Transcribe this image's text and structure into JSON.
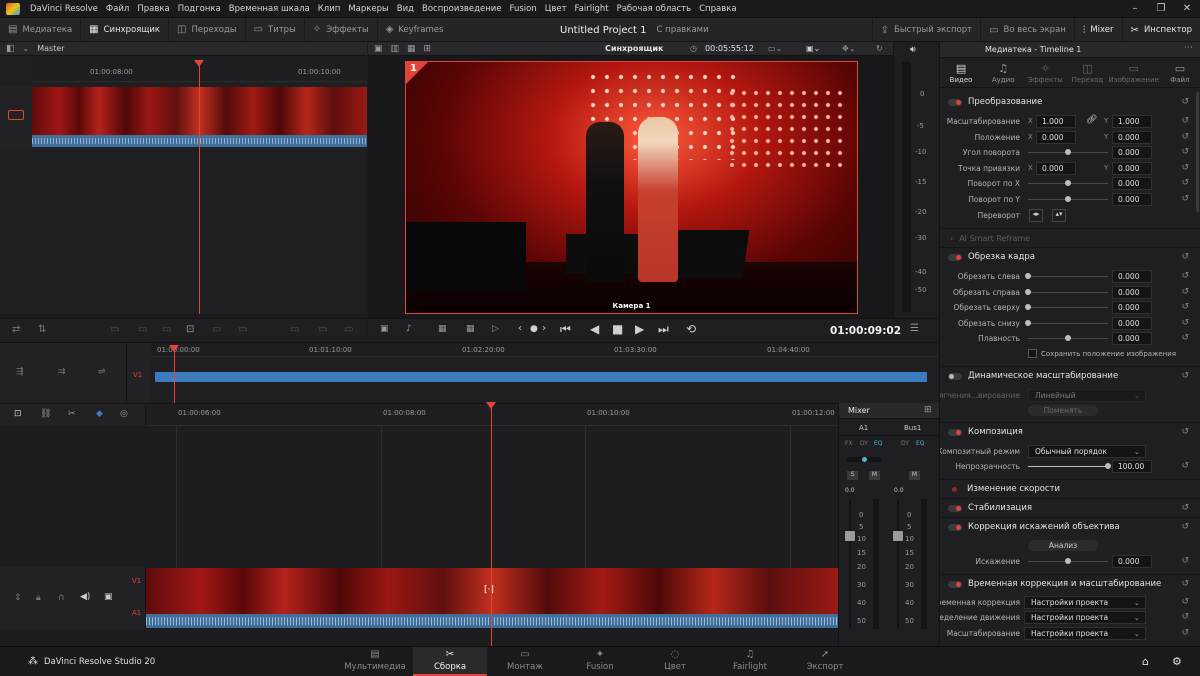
{
  "app": {
    "name": "DaVinci Resolve"
  },
  "menu": [
    "Файл",
    "Правка",
    "Подгонка",
    "Временная шкала",
    "Клип",
    "Маркеры",
    "Вид",
    "Воспроизведение",
    "Fusion",
    "Цвет",
    "Fairlight",
    "Рабочая область",
    "Справка"
  ],
  "toolbar": {
    "media_pool": "Медиатека",
    "sync_bin": "Синхроящик",
    "transitions": "Переходы",
    "titles": "Титры",
    "effects": "Эффекты",
    "keyframes": "Keyframes",
    "project_title": "Untitled Project 1",
    "project_status": "С правками",
    "quick_export": "Быстрый экспорт",
    "fullscreen": "Во весь экран",
    "mixer": "Mixer",
    "inspector": "Инспектор"
  },
  "source_panel": {
    "label": "Master",
    "ticks": [
      "01:00:08:00",
      "01:00:10:00"
    ]
  },
  "viewer": {
    "title": "Синхроящик",
    "timecode": "00:05:55:12",
    "cam_number": "1",
    "cam_label": "Камера 1",
    "playhead_tc": "01:00:09:02"
  },
  "upper_timeline": {
    "track": "V1",
    "ticks": [
      "01:00:00:00",
      "01:01:10:00",
      "01:02:20:00",
      "01:03:30:00",
      "01:04:40:00"
    ]
  },
  "lower_timeline": {
    "ticks": [
      "01:00:06:00",
      "01:00:08:00",
      "01:00:10:00",
      "01:00:12:00"
    ],
    "video_track": "V1",
    "audio_track": "A1"
  },
  "mixer": {
    "title": "Mixer",
    "channels": [
      "A1",
      "Bus1"
    ],
    "a1_fx": [
      "FX",
      "DY",
      "EQ"
    ],
    "bus_fx": [
      "DY",
      "EQ"
    ],
    "solo": "S",
    "mute": "M",
    "level": "0.0",
    "scale": [
      "0",
      "5",
      "10",
      "15",
      "20",
      "30",
      "40",
      "50"
    ]
  },
  "meter_scale": [
    "0",
    "-5",
    "-10",
    "-15",
    "-20",
    "-30",
    "-40",
    "-50"
  ],
  "inspector": {
    "header": "Медиатека - Timeline 1",
    "tabs": [
      "Видео",
      "Аудио",
      "Эффекты",
      "Переход",
      "Изображение",
      "Файл"
    ],
    "transform": {
      "title": "Преобразование",
      "zoom_label": "Масштабирование",
      "zoom_x": "1.000",
      "zoom_y": "1.000",
      "position_label": "Положение",
      "pos_x": "0.000",
      "pos_y": "0.000",
      "rotation_label": "Угол поворота",
      "rotation": "0.000",
      "anchor_label": "Точка привязки",
      "anchor_x": "0.000",
      "anchor_y": "0.000",
      "pitch_label": "Поворот по X",
      "pitch": "0.000",
      "yaw_label": "Поворот по Y",
      "yaw": "0.000",
      "flip_label": "Переворот"
    },
    "smart_reframe": "AI Smart Reframe",
    "crop": {
      "title": "Обрезка кадра",
      "left_label": "Обрезать слева",
      "left": "0.000",
      "right_label": "Обрезать справа",
      "right": "0.000",
      "top_label": "Обрезать сверху",
      "top": "0.000",
      "bottom_label": "Обрезать снизу",
      "bottom": "0.000",
      "softness_label": "Плавность",
      "softness": "0.000",
      "retain_label": "Сохранить положение изображения"
    },
    "dynamic_zoom": {
      "title": "Динамическое масштабирование",
      "ease_label": "Смягчения...вирование",
      "ease_value": "Линейный",
      "swap": "Поменять"
    },
    "composite": {
      "title": "Композиция",
      "mode_label": "Композитный режим",
      "mode": "Обычный порядок",
      "opacity_label": "Непрозрачность",
      "opacity": "100.00"
    },
    "speed_change": "Изменение скорости",
    "stabilization": "Стабилизация",
    "lens": {
      "title": "Коррекция искажений объектива",
      "analyze": "Анализ",
      "distortion_label": "Искажение",
      "distortion": "0.000"
    },
    "retime": {
      "title": "Временная коррекция и масштабирование",
      "retime_label": "Временная коррекция",
      "retime_value": "Настройки проекта",
      "motion_label": "Определение движения",
      "motion_value": "Настройки проекта",
      "scaling_label": "Масштабирование",
      "scaling_value": "Настройки проекта"
    }
  },
  "pagebar": {
    "product": "DaVinci Resolve Studio 20",
    "pages": [
      "Мультимедиа",
      "Сборка",
      "Монтаж",
      "Fusion",
      "Цвет",
      "Fairlight",
      "Экспорт"
    ]
  },
  "colors": {
    "accent": "#e0443b",
    "clip_audio": "#3f6f9a",
    "timeline_bar": "#3d7bbf"
  }
}
